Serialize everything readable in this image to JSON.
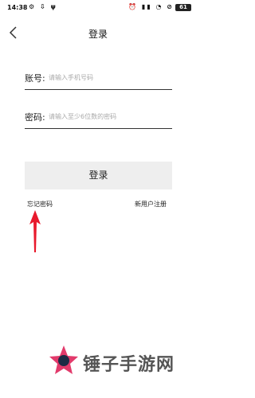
{
  "status_bar": {
    "time": "14:38",
    "battery": "61"
  },
  "nav": {
    "title": "登录"
  },
  "form": {
    "account_label": "账号:",
    "account_placeholder": "请输入手机号码",
    "password_label": "密码:",
    "password_placeholder": "请输入至少6位数的密码",
    "login_label": "登录",
    "forgot_label": "忘记密码",
    "register_label": "新用户注册"
  },
  "watermark": {
    "text": "锤子手游网"
  },
  "colors": {
    "arrow": "#e8192c",
    "button_bg": "#eeeeee"
  }
}
